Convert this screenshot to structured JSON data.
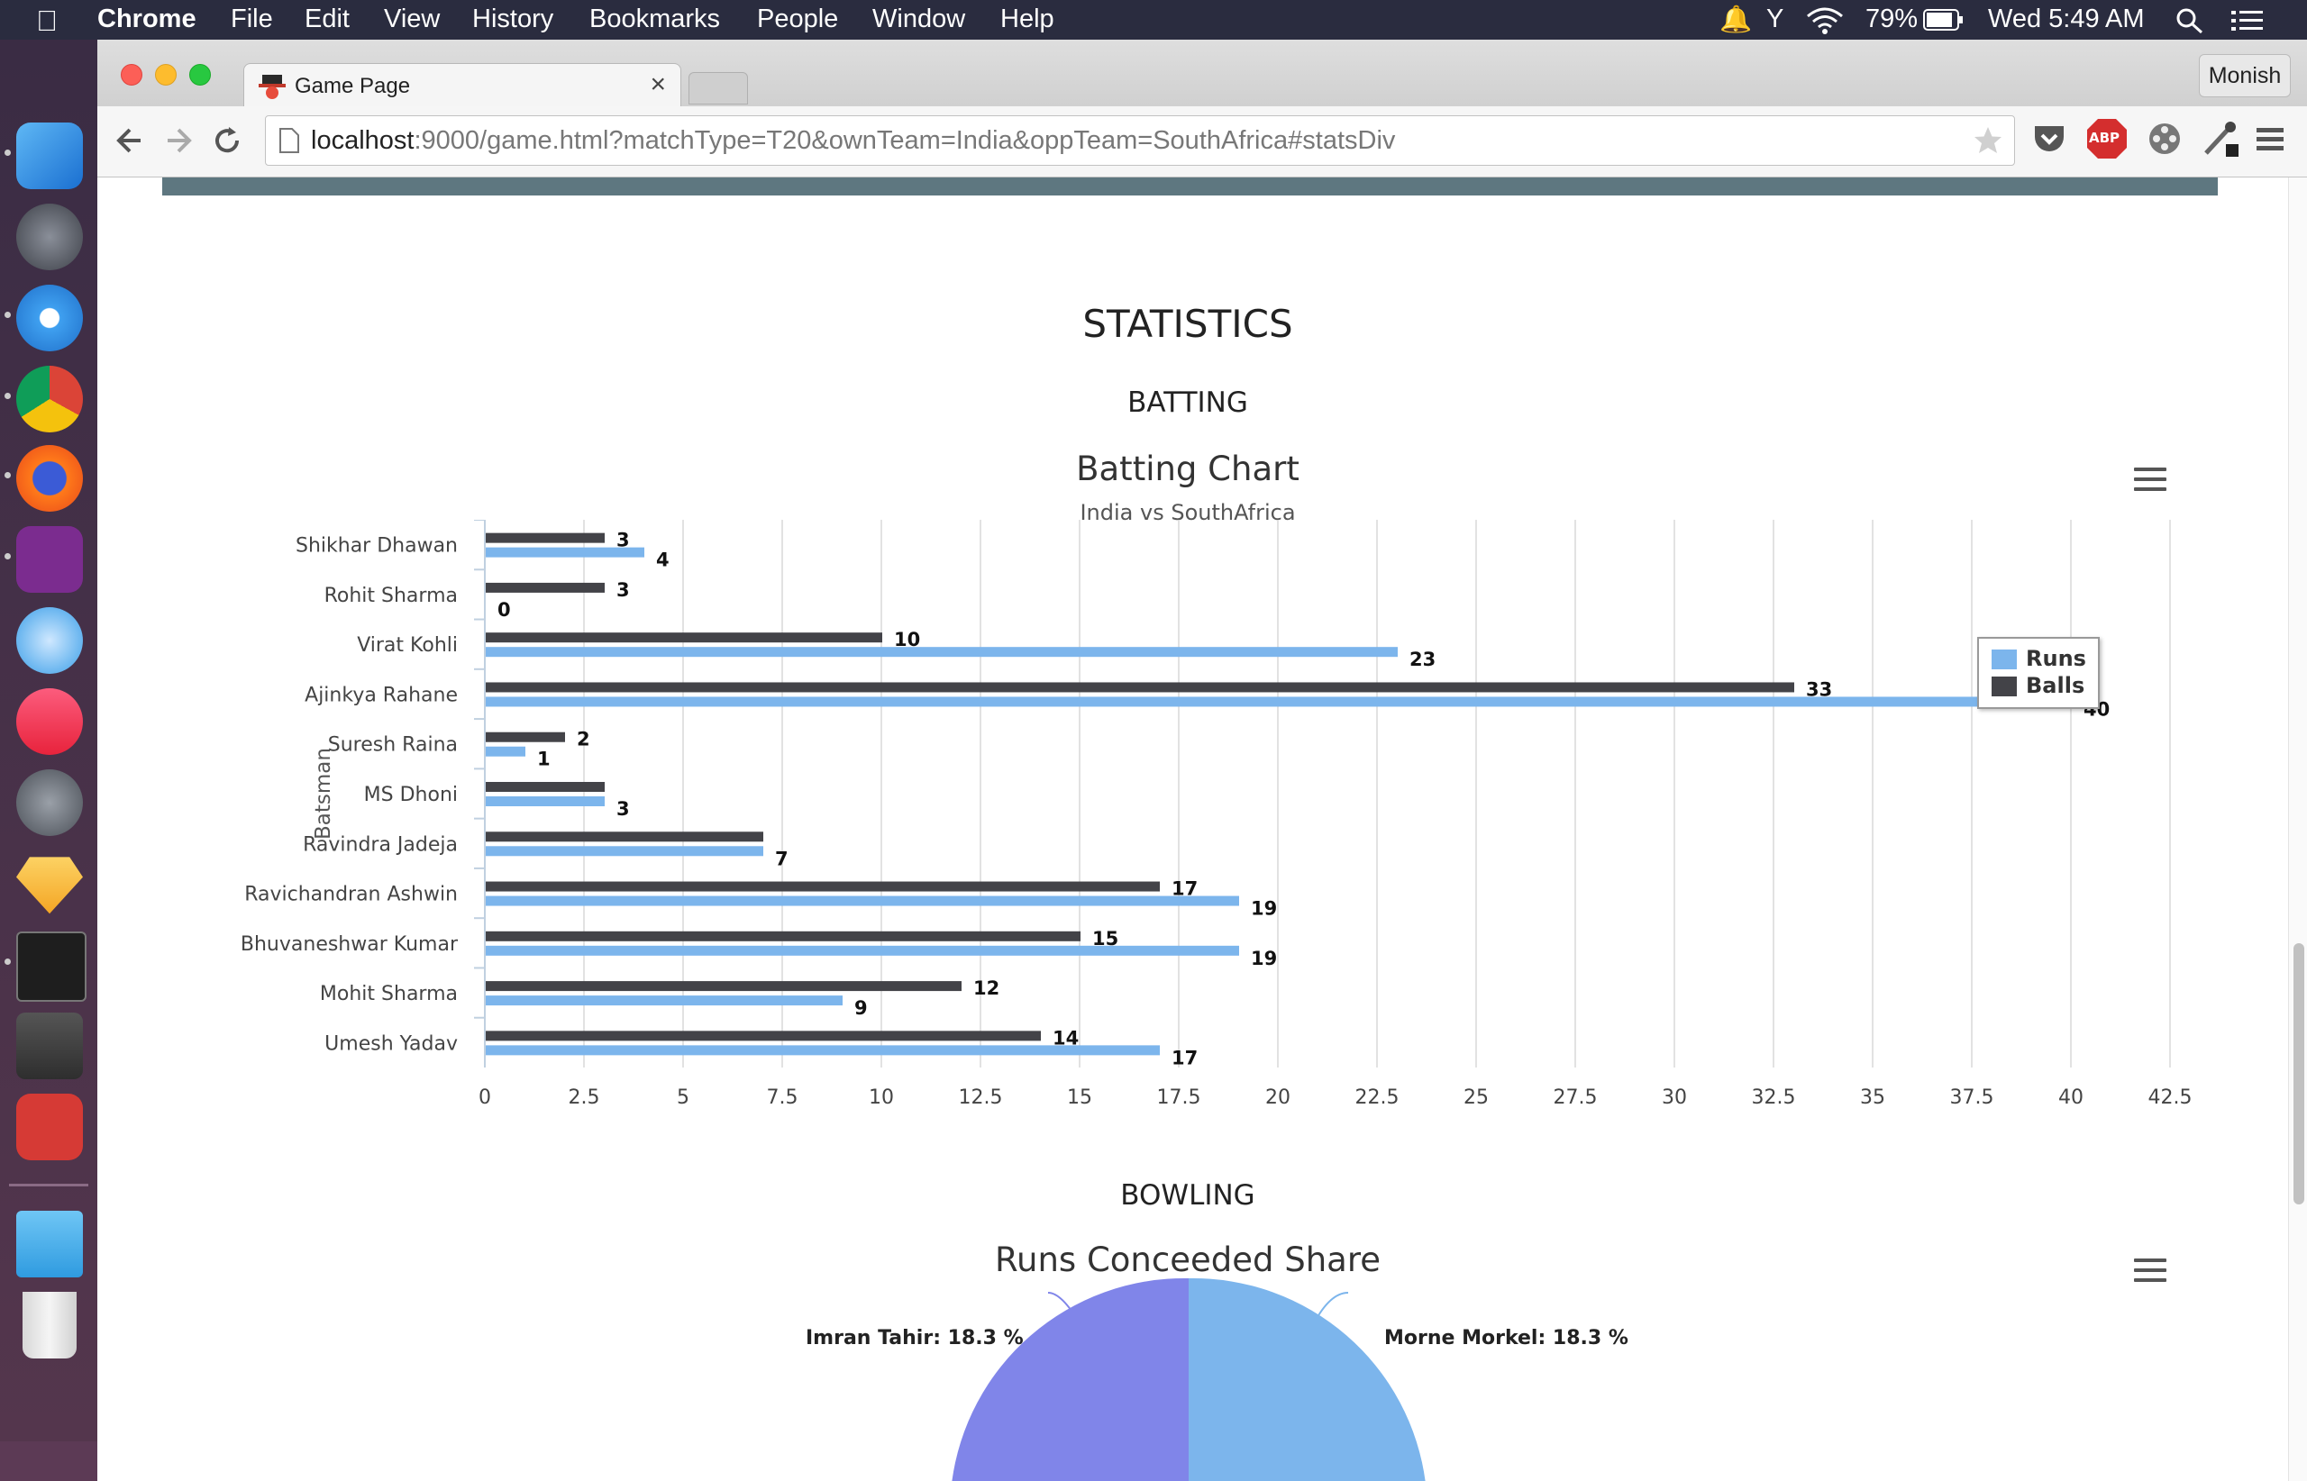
{
  "menubar": {
    "apple_icon": "apple-icon",
    "app_name": "Chrome",
    "items": [
      "File",
      "Edit",
      "View",
      "History",
      "Bookmarks",
      "People",
      "Window",
      "Help"
    ],
    "battery": "79%",
    "clock": "Wed 5:49 AM"
  },
  "browser": {
    "tab_title": "Game Page",
    "tab_close": "×",
    "profile_name": "Monish",
    "url_host": "localhost",
    "url_rest": ":9000/game.html?matchType=T20&ownTeam=India&oppTeam=SouthAfrica#statsDiv",
    "extensions": [
      "pocket-icon",
      "adblock-icon",
      "film-icon",
      "eyedropper-icon",
      "chrome-menu-icon"
    ],
    "adblock_label": "ABP"
  },
  "page": {
    "section_title": "STATISTICS",
    "batting_title": "BATTING",
    "bowling_title": "BOWLING",
    "pie_title": "Runs Conceeded Share",
    "pie_labels": [
      "Imran Tahir: 18.3 %",
      "Morne Morkel: 18.3 %"
    ]
  },
  "colors": {
    "runs": "#7cb5ec",
    "balls": "#434348",
    "pie_a": "#8085e9",
    "pie_b": "#7cb5ec",
    "header_bar": "#5e7780"
  },
  "chart_data": {
    "type": "bar",
    "orientation": "horizontal",
    "title": "Batting Chart",
    "subtitle": "India vs SouthAfrica",
    "ylabel": "Batsman",
    "xlabel": "",
    "categories": [
      "Shikhar Dhawan",
      "Rohit Sharma",
      "Virat Kohli",
      "Ajinkya Rahane",
      "Suresh Raina",
      "MS Dhoni",
      "Ravindra Jadeja",
      "Ravichandran Ashwin",
      "Bhuvaneshwar Kumar",
      "Mohit Sharma",
      "Umesh Yadav"
    ],
    "series": [
      {
        "name": "Balls",
        "values": [
          3,
          3,
          10,
          33,
          2,
          3,
          7,
          17,
          15,
          12,
          14
        ],
        "labels": [
          "3",
          "3",
          "10",
          "33",
          "2",
          "",
          "",
          "17",
          "15",
          "12",
          "14"
        ]
      },
      {
        "name": "Runs",
        "values": [
          4,
          0,
          23,
          40,
          1,
          3,
          7,
          19,
          19,
          9,
          17
        ],
        "labels": [
          "4",
          "0",
          "23",
          "40",
          "1",
          "3",
          "7",
          "19",
          "19",
          "9",
          "17"
        ]
      }
    ],
    "xlim": [
      0,
      42.5
    ],
    "xticks": [
      "0",
      "2.5",
      "5",
      "7.5",
      "10",
      "12.5",
      "15",
      "17.5",
      "20",
      "22.5",
      "25",
      "27.5",
      "30",
      "32.5",
      "35",
      "37.5",
      "40",
      "42.5"
    ],
    "grid": true,
    "legend": "right"
  }
}
